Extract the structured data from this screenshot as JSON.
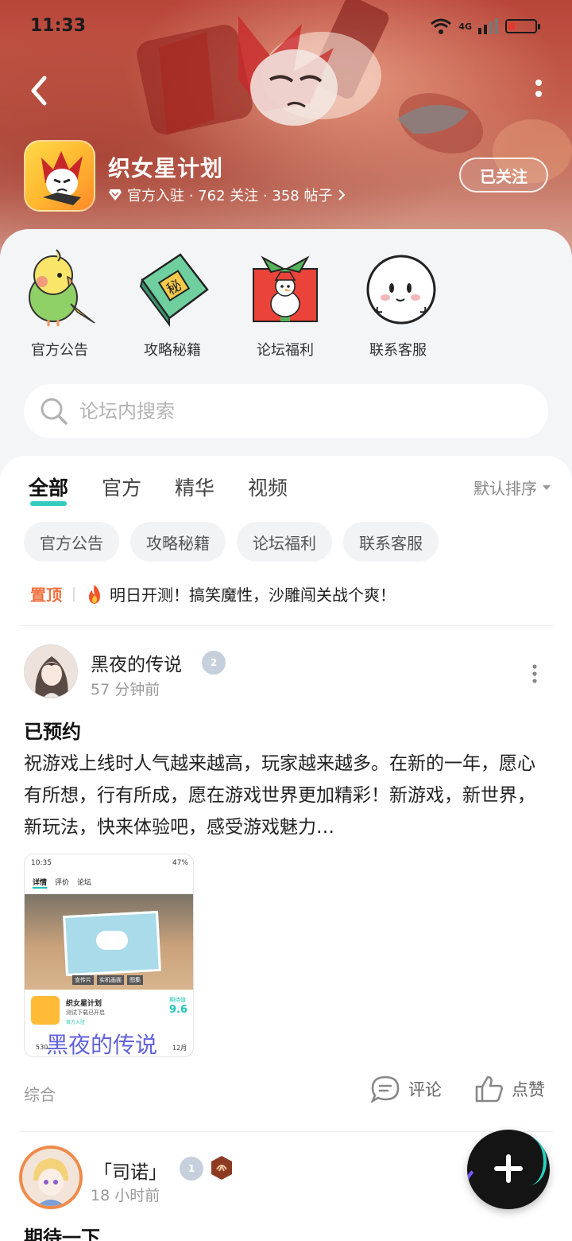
{
  "status_bar": {
    "time": "11:33",
    "network": "4G"
  },
  "header": {
    "title": "织女星计划",
    "meta": "官方入驻 · 762 关注 · 358 帖子",
    "follow_label": "已关注"
  },
  "quick_links": [
    {
      "label": "官方公告",
      "icon": "parrot-icon"
    },
    {
      "label": "攻略秘籍",
      "icon": "secret-book-icon"
    },
    {
      "label": "论坛福利",
      "icon": "gift-box-icon"
    },
    {
      "label": "联系客服",
      "icon": "dumpling-face-icon"
    }
  ],
  "search": {
    "placeholder": "论坛内搜索"
  },
  "tabs": [
    {
      "label": "全部",
      "active": true
    },
    {
      "label": "官方"
    },
    {
      "label": "精华"
    },
    {
      "label": "视频"
    }
  ],
  "sort_label": "默认排序",
  "chips": [
    "官方公告",
    "攻略秘籍",
    "论坛福利",
    "联系客服"
  ],
  "pinned": {
    "tag": "置顶",
    "text": "明日开测！搞笑魔性，沙雕闯关战个爽！"
  },
  "post1": {
    "username": "黑夜的传说",
    "level": "2",
    "time": "57 分钟前",
    "title": "已预约",
    "body": "祝游戏上线时人气越来越高，玩家越来越多。在新的一年，愿心有所想，行有所成，愿在游戏世界更加精彩！新游戏，新世界，新玩法，快来体验吧，感受游戏魅力…",
    "watermark": "黑夜的传说",
    "category": "综合",
    "comment_label": "评论",
    "like_label": "点赞",
    "screenshot": {
      "time": "10:35",
      "battery": "47%",
      "tab_detail": "详情",
      "tab_review": "评价",
      "tab_forum": "论坛",
      "media_tabs": [
        "宣传片",
        "实机画面",
        "图集"
      ],
      "game_name": "织女星计划",
      "game_sub": "测试下载已开启",
      "official": "官方入驻",
      "score_label": "期待值",
      "score": "9.6",
      "bottom_left": "530",
      "bottom_right": "12月"
    }
  },
  "post2": {
    "username": "「司诺」",
    "level": "1",
    "time": "18 小时前",
    "title": "期待一下"
  },
  "colors": {
    "accent": "#1ec5b8",
    "pin": "#ee6f3e",
    "watermark": "#4646d2"
  }
}
